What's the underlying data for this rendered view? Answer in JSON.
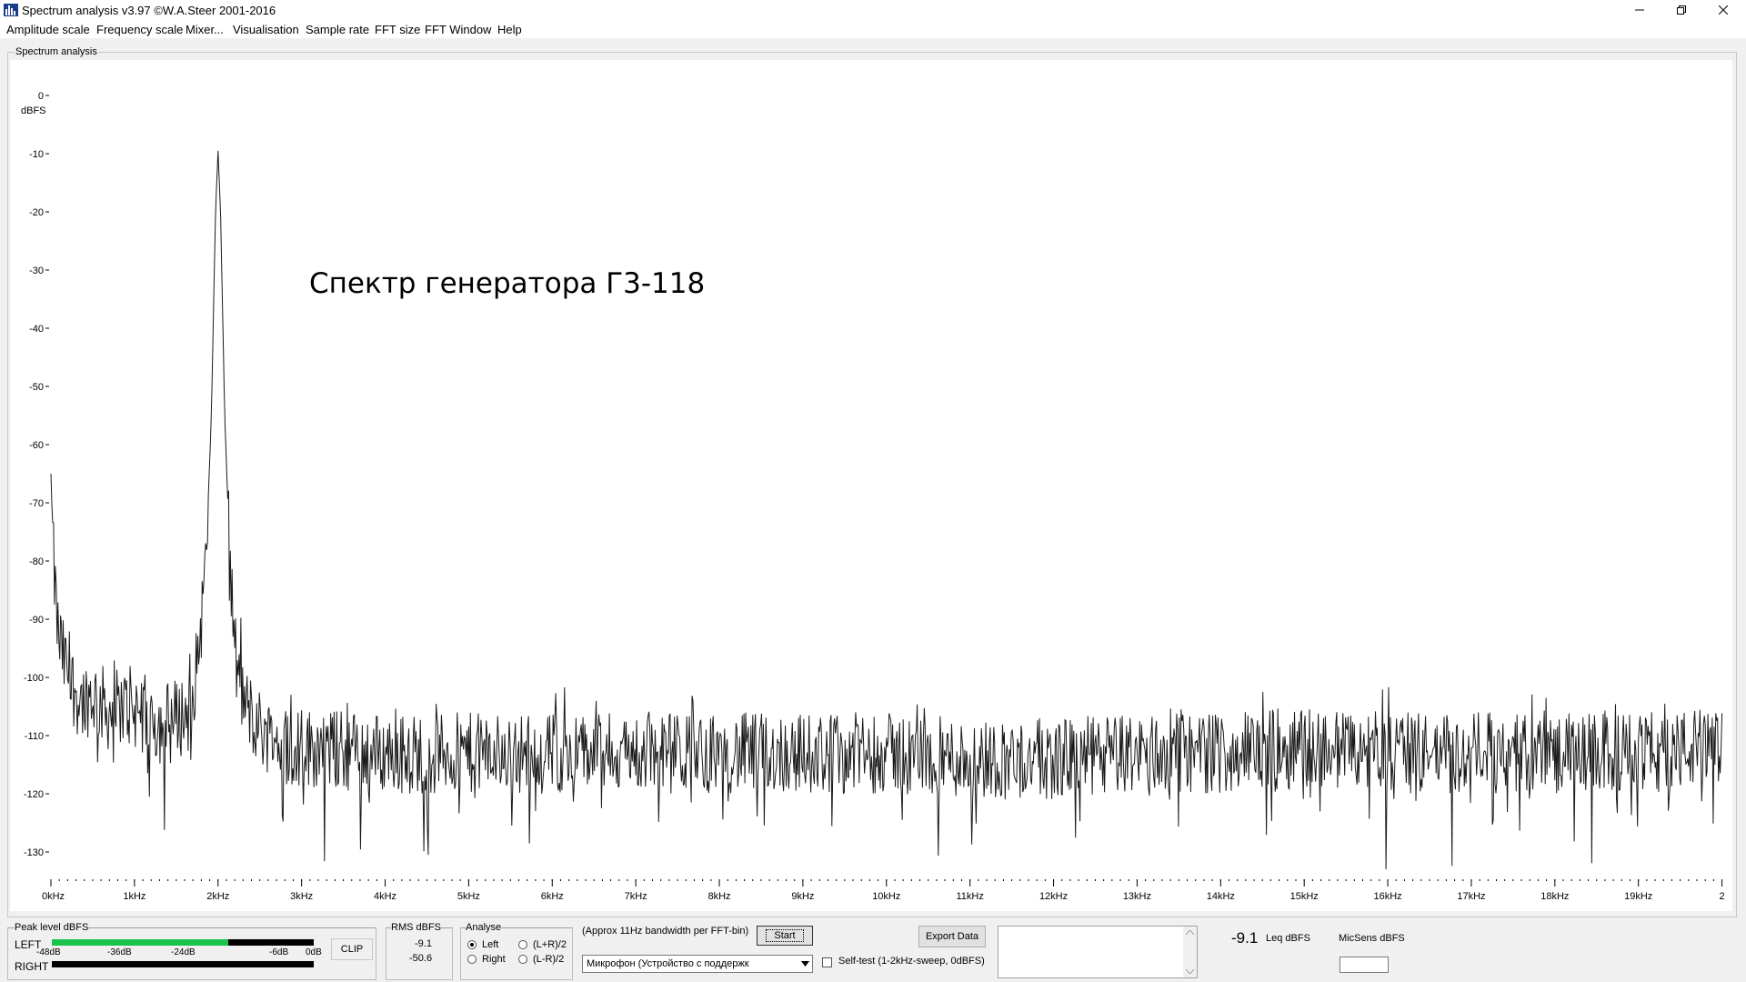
{
  "window": {
    "title": "Spectrum analysis v3.97  ©W.A.Steer 2001-2016",
    "minimize_icon": "minimize-icon",
    "restore_icon": "restore-icon",
    "close_icon": "close-icon"
  },
  "menu": [
    "Amplitude scale",
    "Frequency scale",
    "Mixer...",
    "Visualisation",
    "Sample rate",
    "FFT size",
    "FFT Window",
    "Help"
  ],
  "spectrum_group_title": "Spectrum analysis",
  "annotation": "Спектр генератора Г3-118",
  "chart_data": {
    "type": "line",
    "ylabel": "dBFS",
    "ylim": [
      -135,
      0
    ],
    "xlim_khz": [
      0,
      20
    ],
    "y_ticks": [
      0,
      -10,
      -20,
      -30,
      -40,
      -50,
      -60,
      -70,
      -80,
      -90,
      -100,
      -110,
      -120,
      -130
    ],
    "y_tick_labels": [
      "0",
      "-10",
      "-20",
      "-30",
      "-40",
      "-50",
      "-60",
      "-70",
      "-80",
      "-90",
      "-100",
      "-110",
      "-120",
      "-130"
    ],
    "x_ticks_khz": [
      0,
      1,
      2,
      3,
      4,
      5,
      6,
      7,
      8,
      9,
      10,
      11,
      12,
      13,
      14,
      15,
      16,
      17,
      18,
      19,
      20
    ],
    "x_tick_labels": [
      "0kHz",
      "1kHz",
      "2kHz",
      "3kHz",
      "4kHz",
      "5kHz",
      "6kHz",
      "7kHz",
      "8kHz",
      "9kHz",
      "10kHz",
      "11kHz",
      "12kHz",
      "13kHz",
      "14kHz",
      "15kHz",
      "16kHz",
      "17kHz",
      "18kHz",
      "19kHz",
      "2"
    ],
    "series": [
      {
        "peak_freq_khz": 2.0,
        "peak_level_dbfs": -9.5,
        "noise_floor_dbfs": -113,
        "low_freq_start_dbfs": -65,
        "points": [
          [
            0.0,
            -65
          ],
          [
            0.03,
            -80
          ],
          [
            0.08,
            -92
          ],
          [
            0.15,
            -97
          ],
          [
            0.25,
            -101
          ],
          [
            0.35,
            -104
          ],
          [
            0.5,
            -103
          ],
          [
            0.7,
            -106
          ],
          [
            0.9,
            -105
          ],
          [
            1.1,
            -106
          ],
          [
            1.3,
            -108
          ],
          [
            1.5,
            -107
          ],
          [
            1.65,
            -106
          ],
          [
            1.75,
            -98
          ],
          [
            1.85,
            -82
          ],
          [
            1.92,
            -55
          ],
          [
            1.97,
            -20
          ],
          [
            2.0,
            -9.5
          ],
          [
            2.03,
            -20
          ],
          [
            2.08,
            -55
          ],
          [
            2.15,
            -83
          ],
          [
            2.22,
            -98
          ],
          [
            2.3,
            -104
          ],
          [
            2.45,
            -108
          ],
          [
            2.7,
            -111
          ],
          [
            3.0,
            -112
          ],
          [
            4.0,
            -113
          ],
          [
            5.0,
            -113
          ],
          [
            6.0,
            -113
          ],
          [
            7.0,
            -113
          ],
          [
            8.0,
            -113
          ],
          [
            9.0,
            -113
          ],
          [
            10.0,
            -113
          ],
          [
            11.0,
            -114
          ],
          [
            12.0,
            -114
          ],
          [
            13.0,
            -113
          ],
          [
            14.0,
            -113
          ],
          [
            15.0,
            -112
          ],
          [
            16.0,
            -113
          ],
          [
            17.0,
            -113
          ],
          [
            18.0,
            -113
          ],
          [
            19.0,
            -113
          ],
          [
            20.0,
            -112
          ]
        ]
      }
    ]
  },
  "peak_level": {
    "title": "Peak level dBFS",
    "left_label": "LEFT",
    "right_label": "RIGHT",
    "scale": [
      "-48dB",
      "-36dB",
      "-24dB",
      "-6dB",
      "0dB"
    ],
    "left_level_dbfs": -9.1,
    "right_level_dbfs": -50.6,
    "clip_label": "CLIP",
    "colors": {
      "green": "#19c24a",
      "black": "#000000"
    }
  },
  "rms": {
    "title": "RMS dBFS",
    "left": "-9.1",
    "right": "-50.6"
  },
  "analyse": {
    "title": "Analyse",
    "options": [
      "Left",
      "Right",
      "(L+R)/2",
      "(L-R)/2"
    ],
    "selected": "Left"
  },
  "bandwidth_text": "(Approx 11Hz bandwidth per FFT-bin)",
  "start_button": "Start",
  "device_select": "Микрофон (Устройство с поддержк",
  "selftest_label": "Self-test  (1-2kHz-sweep, 0dBFS)",
  "export_button": "Export Data",
  "leq_value": "-9.1",
  "leq_label": "Leq dBFS",
  "micsens_label": "MicSens dBFS",
  "micsens_value": ""
}
